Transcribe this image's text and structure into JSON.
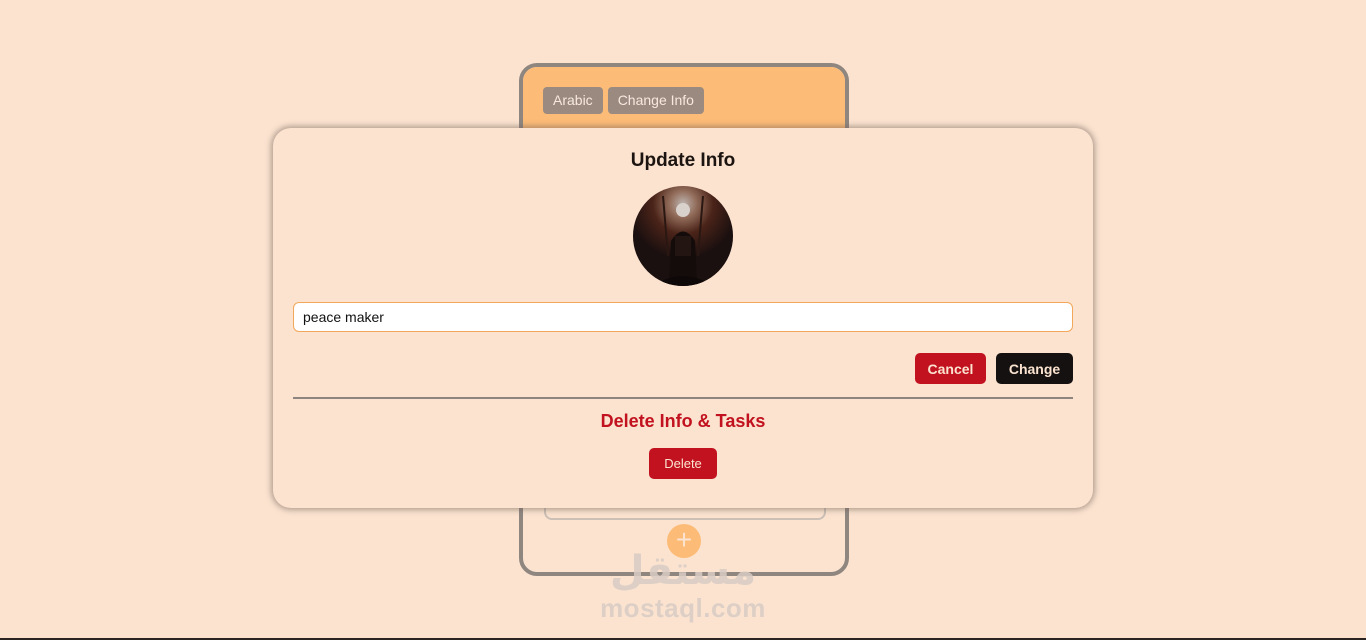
{
  "app": {
    "language_button": "Arabic",
    "change_info_button": "Change Info",
    "add_icon": "plus-icon"
  },
  "modal": {
    "title": "Update Info",
    "avatar_icon": "avatar-image",
    "name_value": "peace maker",
    "cancel_label": "Cancel",
    "change_label": "Change",
    "delete_section_title": "Delete Info & Tasks",
    "delete_label": "Delete"
  },
  "watermark": {
    "arabic": "مستقل",
    "latin": "mostaql.com"
  },
  "colors": {
    "background": "#fbe3d0",
    "header_accent": "#fcbc77",
    "danger": "#c2121f",
    "dark": "#141110",
    "muted_button": "#9a8a80"
  }
}
